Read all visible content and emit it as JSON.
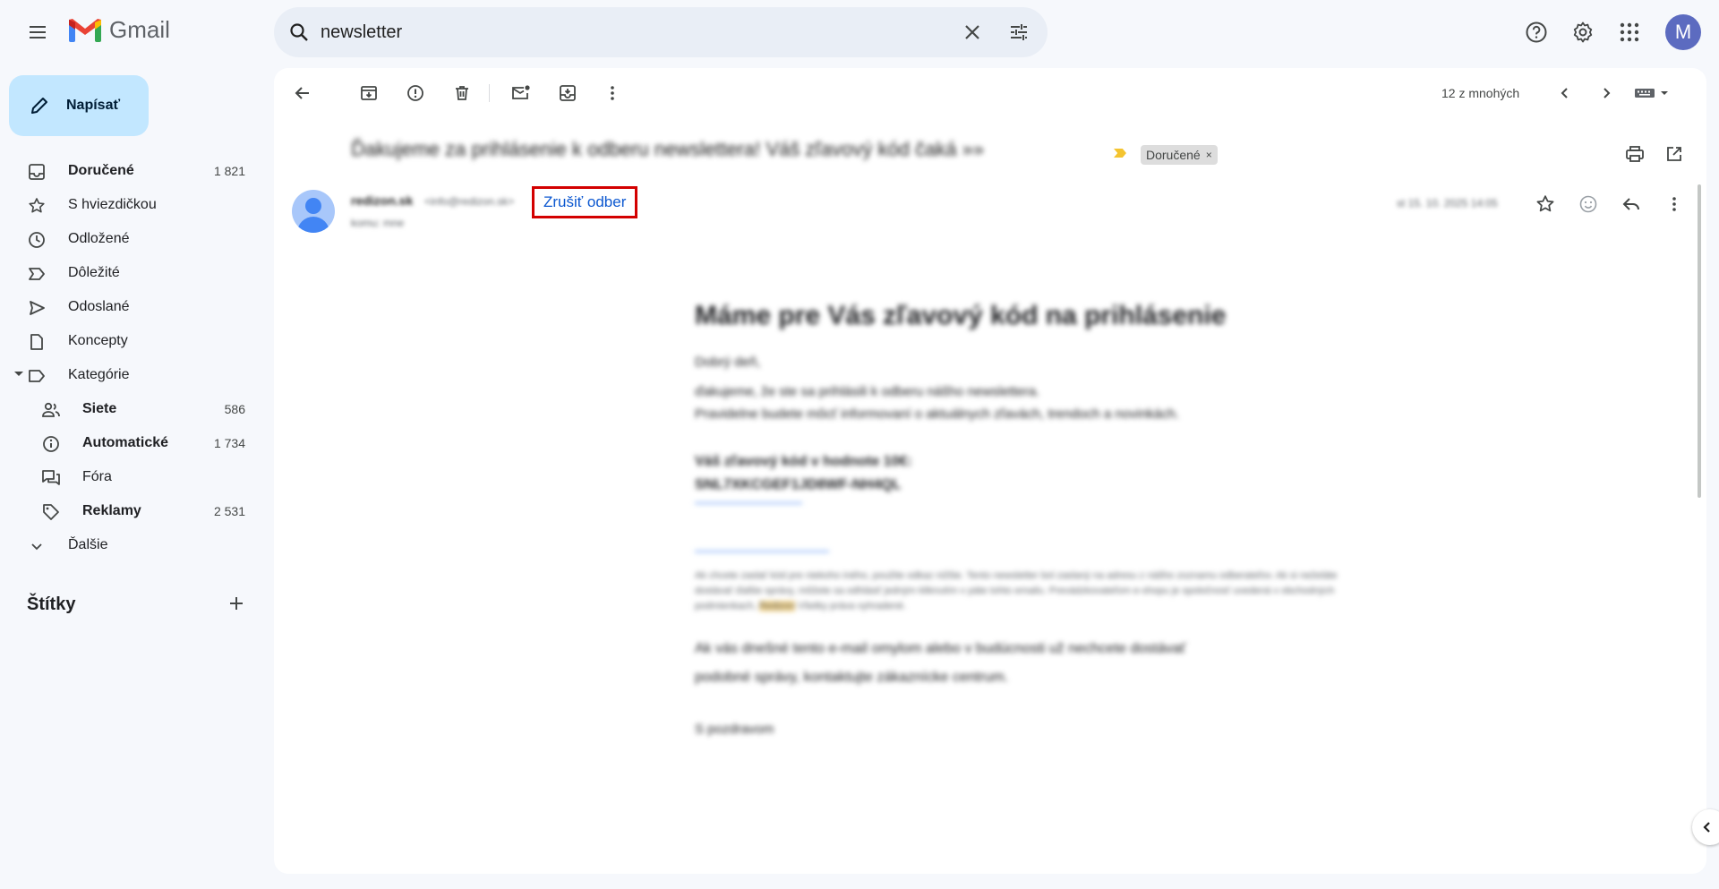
{
  "app": {
    "name": "Gmail"
  },
  "search": {
    "value": "newsletter"
  },
  "account": {
    "initial": "M",
    "avatar_color": "#5c6bc0"
  },
  "compose": {
    "label": "Napísať"
  },
  "sidebar": {
    "items": [
      {
        "label": "Doručené",
        "count": "1 821",
        "icon": "inbox-icon",
        "bold": true
      },
      {
        "label": "S hviezdičkou",
        "count": "",
        "icon": "star-icon"
      },
      {
        "label": "Odložené",
        "count": "",
        "icon": "clock-icon"
      },
      {
        "label": "Dôležité",
        "count": "",
        "icon": "important-icon"
      },
      {
        "label": "Odoslané",
        "count": "",
        "icon": "send-icon"
      },
      {
        "label": "Koncepty",
        "count": "",
        "icon": "draft-icon"
      },
      {
        "label": "Kategórie",
        "count": "",
        "icon": "label-icon"
      }
    ],
    "categories": [
      {
        "label": "Siete",
        "count": "586",
        "icon": "people-icon",
        "bold": true
      },
      {
        "label": "Automatické",
        "count": "1 734",
        "icon": "info-icon",
        "bold": true
      },
      {
        "label": "Fóra",
        "count": "",
        "icon": "forum-icon",
        "bold": false
      },
      {
        "label": "Reklamy",
        "count": "2 531",
        "icon": "tag-icon",
        "bold": true
      }
    ],
    "more": "Ďalšie",
    "labels_heading": "Štítky"
  },
  "toolbar": {
    "pager": "12 z mnohých"
  },
  "message": {
    "subject": "Ďakujeme za prihlásenie k odberu newslettera! Váš zľavový kód čaká »»",
    "label_chip": "Doručené",
    "sender_name": "redizon.sk",
    "sender_email": "<info@redizon.sk>",
    "recipient": "komu: mne",
    "unsubscribe": "Zrušiť odber",
    "date": "st 15. 10. 2025 14:05"
  },
  "email_body": {
    "heading": "Máme pre Vás zľavový kód na prihlásenie",
    "greeting": "Dobrý deň,",
    "p1": "ďakujeme, že ste sa prihlásili k odberu nášho newslettera.",
    "p2": "Pravidelne budete môcť informovaní o aktuálnych zľavách, trendoch a novinkách.",
    "code_line1": "Váš zľavový kód v hodnote 10€:",
    "code_line2": "SNL7XKCGEF1JD8WF-NH4QL",
    "legal1": "Ak chcete zaslať kód pre niekoho iného, použite odkaz nižšie. Tento newsletter bol zaslaný na adresu z nášho zoznamu odberateľov.",
    "legal2": "Ak si neželáte dostávať ďalšie správy, môžete sa odhlásiť jedným kliknutím v päte tohto emailu.",
    "legal3": "Prevádzkovateľom e-shopu je spoločnosť uvedená v obchodných podmienkach,",
    "legal_highlight": "Redizon",
    "legal4": "Všetky práva vyhradené.",
    "p3": "Ak vás dnešné tento e-mail omylom alebo v budúcnosti už nechcete dostávať",
    "p4": "podobné správy, kontaktujte zákaznícke centrum.",
    "sign": "S pozdravom"
  }
}
